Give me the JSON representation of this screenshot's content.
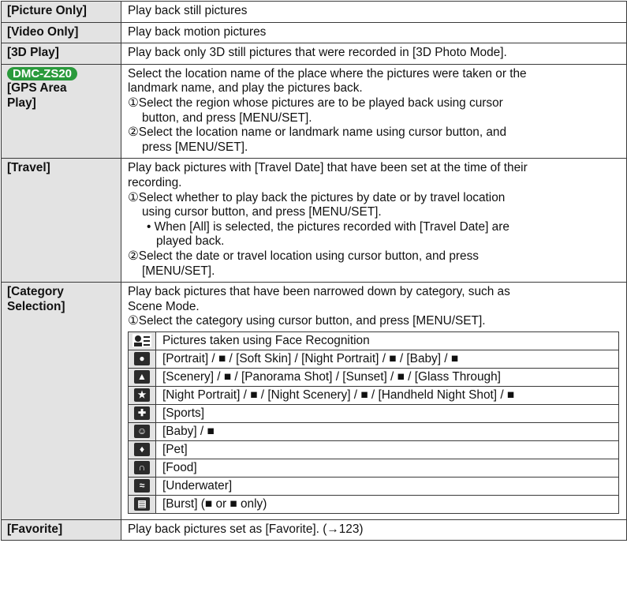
{
  "rows": {
    "picture_only": {
      "label": "[Picture Only]",
      "desc": "Play back still pictures"
    },
    "video_only": {
      "label": "[Video Only]",
      "desc": "Play back motion pictures"
    },
    "play_3d": {
      "label": "[3D Play]",
      "desc": "Play back only 3D still pictures that were recorded in [3D Photo Mode]."
    },
    "gps": {
      "badge": "DMC-ZS20",
      "label_1": "[GPS Area",
      "label_2": "Play]",
      "lines": [
        "Select the location name of the place where the pictures were taken or the",
        "landmark name, and play the pictures back.",
        "①Select the region whose pictures are to be played back using cursor",
        "button, and press [MENU/SET].",
        "②Select the location name or landmark name using cursor button, and",
        "press [MENU/SET]."
      ]
    },
    "travel": {
      "label": "[Travel]",
      "lines": [
        "Play back pictures with [Travel Date] that have been set at the time of their",
        "recording.",
        "①Select whether to play back the pictures by date or by travel location",
        "using cursor button, and press [MENU/SET].",
        "• When [All] is selected, the pictures recorded with [Travel Date] are",
        "played back.",
        "②Select the date or travel location using cursor button, and press",
        "[MENU/SET]."
      ]
    },
    "category": {
      "label_1": "[Category",
      "label_2": "Selection]",
      "lines": [
        "Play back pictures that have been narrowed down by category, such as",
        "Scene Mode.",
        "①Select the category using cursor button, and press [MENU/SET]."
      ],
      "items": [
        {
          "icon": "face-recognition-icon",
          "text": "Pictures taken using Face Recognition"
        },
        {
          "icon": "portrait-icon",
          "text": "[Portrait] / ■ / [Soft Skin] / [Night Portrait] / ■ / [Baby] / ■"
        },
        {
          "icon": "scenery-icon",
          "text": "[Scenery] / ■ / [Panorama Shot] / [Sunset] / ■ / [Glass Through]"
        },
        {
          "icon": "night-portrait-icon",
          "text": "[Night Portrait] / ■ / [Night Scenery] / ■ / [Handheld Night Shot] / ■"
        },
        {
          "icon": "sports-icon",
          "text": "[Sports]"
        },
        {
          "icon": "baby-icon",
          "text": "[Baby] / ■"
        },
        {
          "icon": "pet-icon",
          "text": "[Pet]"
        },
        {
          "icon": "food-icon",
          "text": "[Food]"
        },
        {
          "icon": "underwater-icon",
          "text": "[Underwater]"
        },
        {
          "icon": "burst-icon",
          "text": "[Burst] (■ or ■ only)"
        }
      ]
    },
    "favorite": {
      "label": "[Favorite]",
      "desc": "Play back pictures set as [Favorite]. (→123)"
    }
  }
}
